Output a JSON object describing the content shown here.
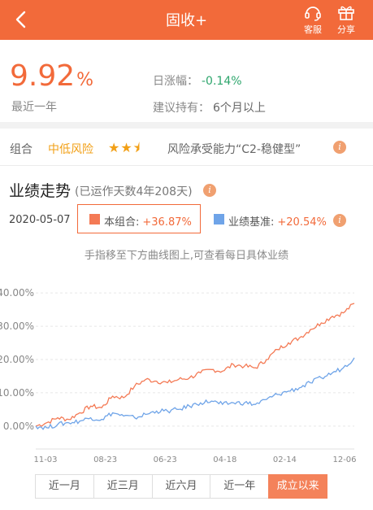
{
  "header": {
    "title": "固收+",
    "service_label": "客服",
    "share_label": "分享"
  },
  "summary": {
    "rate_value": "9.92",
    "rate_unit": "%",
    "rate_caption": "最近一年",
    "day_change_label": "日涨幅：",
    "day_change_value": "-0.14%",
    "hold_label": "建议持有：",
    "hold_value": "6个月以上"
  },
  "combo": {
    "label": "组合",
    "risk_level": "中低风险",
    "stars": "★★⯨",
    "capability": "风险承受能力“C2-稳健型”"
  },
  "performance": {
    "title": "业绩走势",
    "subtitle": "(已运作天数4年208天)",
    "date": "2020-05-07",
    "combo_legend_label": "本组合:",
    "combo_legend_value": "+36.87%",
    "bench_legend_label": "业绩基准:",
    "bench_legend_value": "+20.54%",
    "hint": "手指移至下方曲线图上,可查看每日具体业绩"
  },
  "chart_data": {
    "type": "line",
    "x": [
      "11-03",
      "08-23",
      "06-23",
      "04-18",
      "02-14",
      "12-06"
    ],
    "y_ticks": [
      "40.00%",
      "30.00%",
      "20.00%",
      "10.00%",
      "0.00%"
    ],
    "ylim": [
      -2,
      42
    ],
    "grid": true,
    "series": [
      {
        "name": "本组合",
        "color": "#f47a55",
        "values": [
          0,
          1,
          2.5,
          2,
          4,
          6,
          5.5,
          9,
          8.5,
          12,
          14,
          13.5,
          13,
          14,
          14.5,
          16,
          17,
          16.5,
          18.5,
          18,
          17.5,
          20,
          23,
          25,
          26.5,
          29,
          31,
          33,
          34,
          36.87
        ]
      },
      {
        "name": "业绩基准",
        "color": "#6fa4e8",
        "values": [
          0,
          -0.5,
          0.5,
          1,
          1.5,
          2.5,
          2,
          4,
          3,
          2.5,
          3.5,
          4.5,
          4.5,
          5,
          6,
          7,
          7.5,
          6.5,
          7,
          7,
          6.5,
          8,
          9.5,
          10.5,
          11.5,
          13,
          14.5,
          16,
          17.5,
          20.54
        ]
      }
    ]
  },
  "ranges": [
    {
      "label": "近一月"
    },
    {
      "label": "近三月"
    },
    {
      "label": "近六月"
    },
    {
      "label": "近一年"
    },
    {
      "label": "成立以来"
    }
  ],
  "active_range": 4
}
